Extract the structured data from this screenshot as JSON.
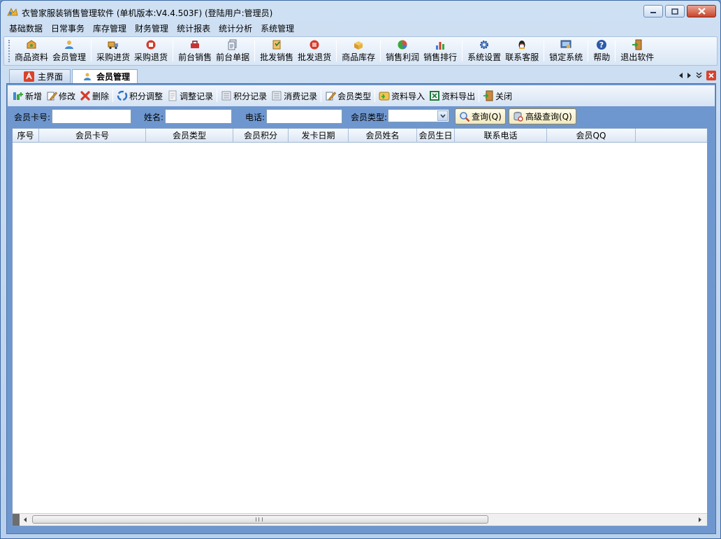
{
  "window": {
    "title": "衣管家服装销售管理软件 (单机版本:V4.4.503F) (登陆用户:管理员)"
  },
  "menu": [
    "基础数据",
    "日常事务",
    "库存管理",
    "财务管理",
    "统计报表",
    "统计分析",
    "系统管理"
  ],
  "toolbar": [
    {
      "label": "商品资料",
      "icon": "goods-icon",
      "color": "#e8a23a"
    },
    {
      "label": "会员管理",
      "icon": "member-icon",
      "color": "#3d8ad6"
    },
    {
      "label": "采购进货",
      "icon": "truck-icon",
      "color": "#d08b2a"
    },
    {
      "label": "采购退货",
      "icon": "return-icon",
      "color": "#d63a2a"
    },
    {
      "label": "前台销售",
      "icon": "cart-icon",
      "color": "#c73434"
    },
    {
      "label": "前台单据",
      "icon": "receipt-icon",
      "color": "#6b7a8f"
    },
    {
      "label": "批发销售",
      "icon": "wholesale-icon",
      "color": "#e0a63b"
    },
    {
      "label": "批发退货",
      "icon": "wholesale-return-icon",
      "color": "#d63a2a"
    },
    {
      "label": "商品库存",
      "icon": "stock-icon",
      "color": "#e6b23e"
    },
    {
      "label": "销售利润",
      "icon": "pie-chart-icon",
      "color": "#3ba83b"
    },
    {
      "label": "销售排行",
      "icon": "bar-chart-icon",
      "color": "#c7402d"
    },
    {
      "label": "系统设置",
      "icon": "settings-icon",
      "color": "#5a86c6"
    },
    {
      "label": "联系客服",
      "icon": "qq-icon",
      "color": "#222222"
    },
    {
      "label": "锁定系统",
      "icon": "lock-icon",
      "color": "#4d7fbf"
    },
    {
      "label": "帮助",
      "icon": "help-icon",
      "color": "#2c5aa8"
    },
    {
      "label": "退出软件",
      "icon": "exit-icon",
      "color": "#3a9a3a"
    }
  ],
  "tabs": {
    "home": "主界面",
    "active": "会员管理"
  },
  "subtoolbar": [
    {
      "label": "新增",
      "icon": "add-icon"
    },
    {
      "label": "修改",
      "icon": "edit-icon"
    },
    {
      "label": "删除",
      "icon": "delete-icon"
    },
    {
      "label": "积分调整",
      "icon": "points-adjust-icon"
    },
    {
      "label": "调整记录",
      "icon": "adjust-record-icon"
    },
    {
      "label": "积分记录",
      "icon": "points-record-icon"
    },
    {
      "label": "消费记录",
      "icon": "consume-record-icon"
    },
    {
      "label": "会员类型",
      "icon": "member-type-icon"
    },
    {
      "label": "资料导入",
      "icon": "import-icon"
    },
    {
      "label": "资料导出",
      "icon": "excel-export-icon"
    },
    {
      "label": "关闭",
      "icon": "close-door-icon"
    }
  ],
  "search": {
    "card_label": "会员卡号:",
    "name_label": "姓名:",
    "phone_label": "电话:",
    "type_label": "会员类型:",
    "query_btn": "查询(Q)",
    "adv_query_btn": "高级查询(Q)"
  },
  "grid": {
    "columns": [
      "序号",
      "会员卡号",
      "会员类型",
      "会员积分",
      "发卡日期",
      "会员姓名",
      "会员生日",
      "联系电话",
      "会员QQ"
    ],
    "rows": []
  },
  "scrollbar": {
    "grip": "III"
  }
}
